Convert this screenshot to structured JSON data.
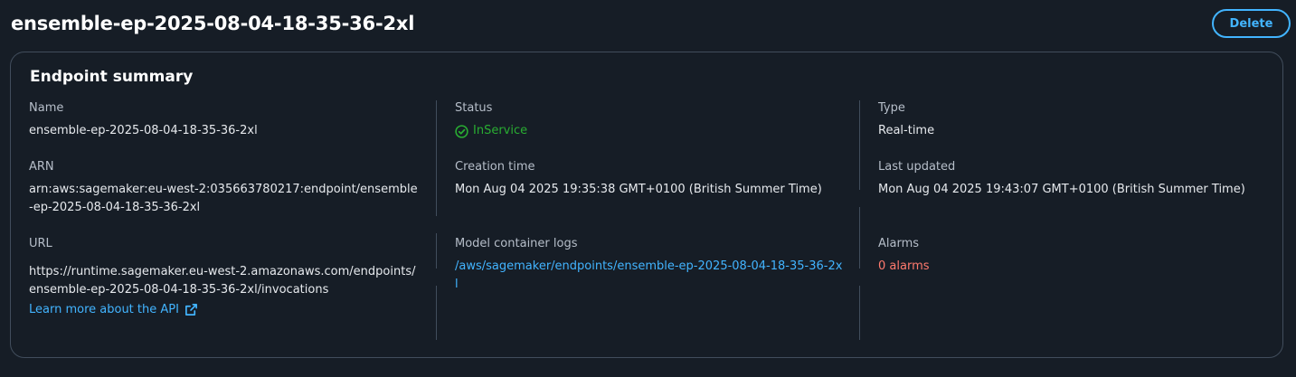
{
  "header": {
    "title": "ensemble-ep-2025-08-04-18-35-36-2xl",
    "delete_label": "Delete"
  },
  "summary": {
    "title": "Endpoint summary",
    "name": {
      "label": "Name",
      "value": "ensemble-ep-2025-08-04-18-35-36-2xl"
    },
    "status": {
      "label": "Status",
      "value": "InService",
      "icon": "check-circle-icon",
      "color": "#29ad32"
    },
    "type": {
      "label": "Type",
      "value": "Real-time"
    },
    "arn": {
      "label": "ARN",
      "value": "arn:aws:sagemaker:eu-west-2:035663780217:endpoint/ensemble-ep-2025-08-04-18-35-36-2xl"
    },
    "creation_time": {
      "label": "Creation time",
      "value": "Mon Aug 04 2025 19:35:38 GMT+0100 (British Summer Time)"
    },
    "last_updated": {
      "label": "Last updated",
      "value": "Mon Aug 04 2025 19:43:07 GMT+0100 (British Summer Time)"
    },
    "url": {
      "label": "URL",
      "value": "https://runtime.sagemaker.eu-west-2.amazonaws.com/endpoints/ensemble-ep-2025-08-04-18-35-36-2xl/invocations",
      "learn_more": "Learn more about the API",
      "learn_more_icon": "external-link-icon"
    },
    "logs": {
      "label": "Model container logs",
      "value": "/aws/sagemaker/endpoints/ensemble-ep-2025-08-04-18-35-36-2xl"
    },
    "alarms": {
      "label": "Alarms",
      "value": "0 alarms",
      "color": "#ff7a6e"
    }
  },
  "colors": {
    "background": "#161d26",
    "border": "#414d5c",
    "accent": "#42b4ff",
    "success": "#29ad32",
    "error": "#ff7a6e"
  }
}
